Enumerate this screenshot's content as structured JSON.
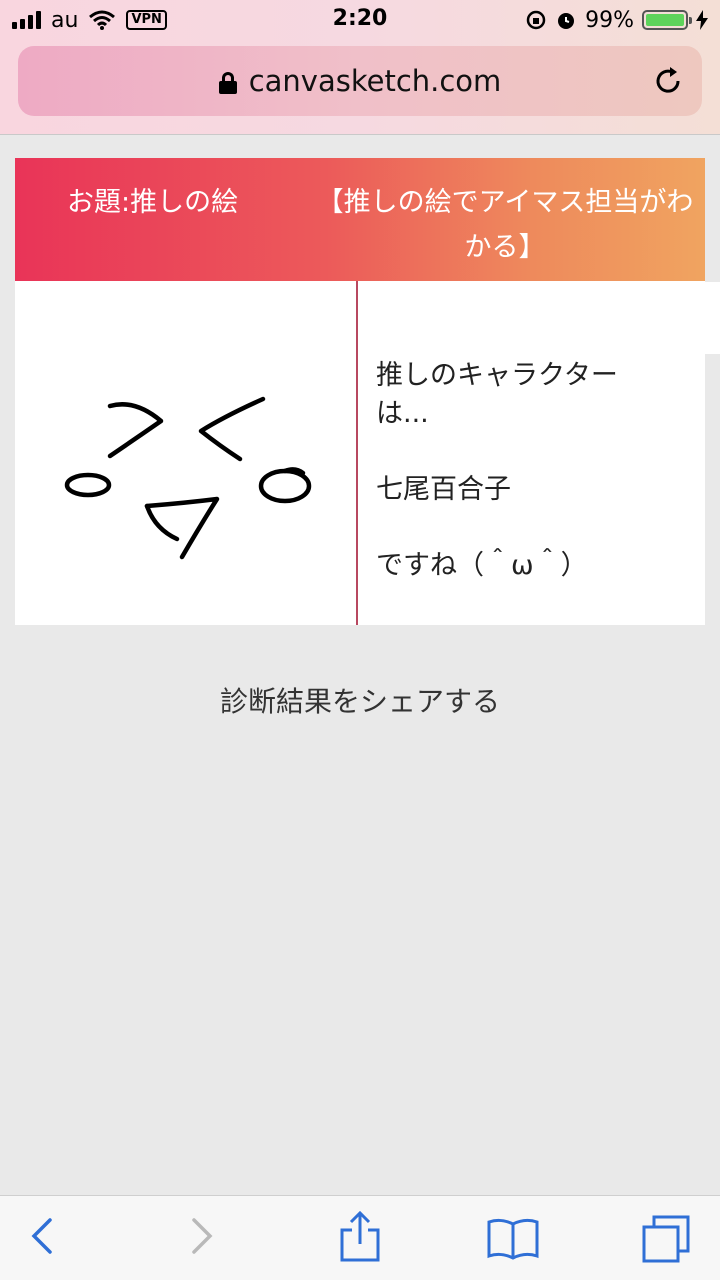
{
  "status_bar": {
    "carrier": "au",
    "vpn": "VPN",
    "time": "2:20",
    "battery": "99%",
    "icons": [
      "signal-icon",
      "wifi-icon",
      "vpn-badge",
      "rotation-lock-icon",
      "alarm-icon",
      "battery-icon",
      "charging-icon"
    ]
  },
  "browser": {
    "url": "canvasketch.com",
    "icons": [
      "lock-icon",
      "reload-icon"
    ]
  },
  "card": {
    "topic": "お題:推しの絵",
    "title": "【推しの絵でアイマス担当がわかる】",
    "result_line1": "推しのキャラクターは...",
    "result_line2": "七尾百合子",
    "result_line3": "ですね（＾ω＾）",
    "accent_colors": [
      "#e93458",
      "#f0a460"
    ]
  },
  "share_label": "診断結果をシェアする",
  "toolbar": {
    "icons": [
      "back-icon",
      "forward-icon",
      "share-icon",
      "bookmarks-icon",
      "tabs-icon"
    ],
    "tint": "#2f6fd6"
  }
}
